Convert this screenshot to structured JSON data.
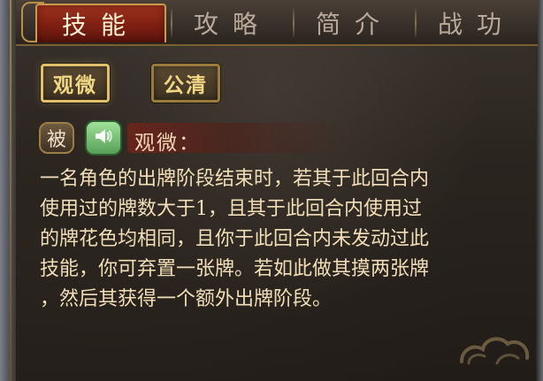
{
  "tabs": [
    {
      "label": "技能",
      "active": true
    },
    {
      "label": "攻略",
      "active": false
    },
    {
      "label": "简介",
      "active": false
    },
    {
      "label": "战功",
      "active": false
    }
  ],
  "skill_buttons": [
    {
      "label": "观微",
      "selected": true
    },
    {
      "label": "公清",
      "selected": false
    }
  ],
  "skill_detail": {
    "type_badge": "被",
    "voice_icon": "speaker-icon",
    "name_label": "观微：",
    "description_lines": [
      "一名角色的出牌阶段结束时，若其于此回合内",
      "使用过的牌数大于1，且其于此回合内使用过",
      "的牌花色均相同，且你于此回合内未发动过此",
      "技能，你可弃置一张牌。若如此做其摸两张牌",
      "，然后其获得一个额外出牌阶段。"
    ]
  },
  "colors": {
    "active_tab": "#a1331e",
    "gold": "#e0c06b",
    "text": "#f3dfb7",
    "voice_green": "#57a05a"
  }
}
